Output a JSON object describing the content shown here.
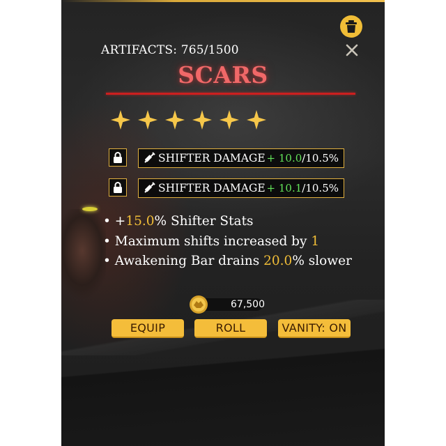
{
  "header": {
    "artifacts_label": "ARTIFACTS: 765/1500",
    "title": "SCARS"
  },
  "rating": {
    "stars": 6,
    "max_shown": 6
  },
  "stats": [
    {
      "name": "SHIFTER DAMAGE",
      "current": "+ 10.0",
      "max": "/10.5%",
      "icon": "syringe-icon",
      "locked": true
    },
    {
      "name": "SHIFTER DAMAGE",
      "current": "+ 10.1",
      "max": "/10.5%",
      "icon": "syringe-icon",
      "locked": true
    }
  ],
  "perks": [
    {
      "bullet": "•",
      "pre": " +",
      "hl": "15.0",
      "post": "% Shifter Stats"
    },
    {
      "bullet": "•",
      "pre": " Maximum shifts increased by ",
      "hl": "1",
      "post": ""
    },
    {
      "bullet": "•",
      "pre": " Awakening Bar drains ",
      "hl": "20.0",
      "post": "% slower"
    }
  ],
  "currency": {
    "amount": "67,500",
    "icon": "gold-coin-icon"
  },
  "buttons": {
    "equip": "EQUIP",
    "roll": "ROLL",
    "vanity": "VANITY: ON"
  },
  "icons": {
    "delete": "trash-icon",
    "close": "close-icon",
    "lock": "lock-icon",
    "star": "star-icon"
  },
  "colors": {
    "gold": "#f0bd37",
    "title_red": "#f06868",
    "rule_red": "#cc1f1f",
    "value_green": "#63e35a"
  }
}
